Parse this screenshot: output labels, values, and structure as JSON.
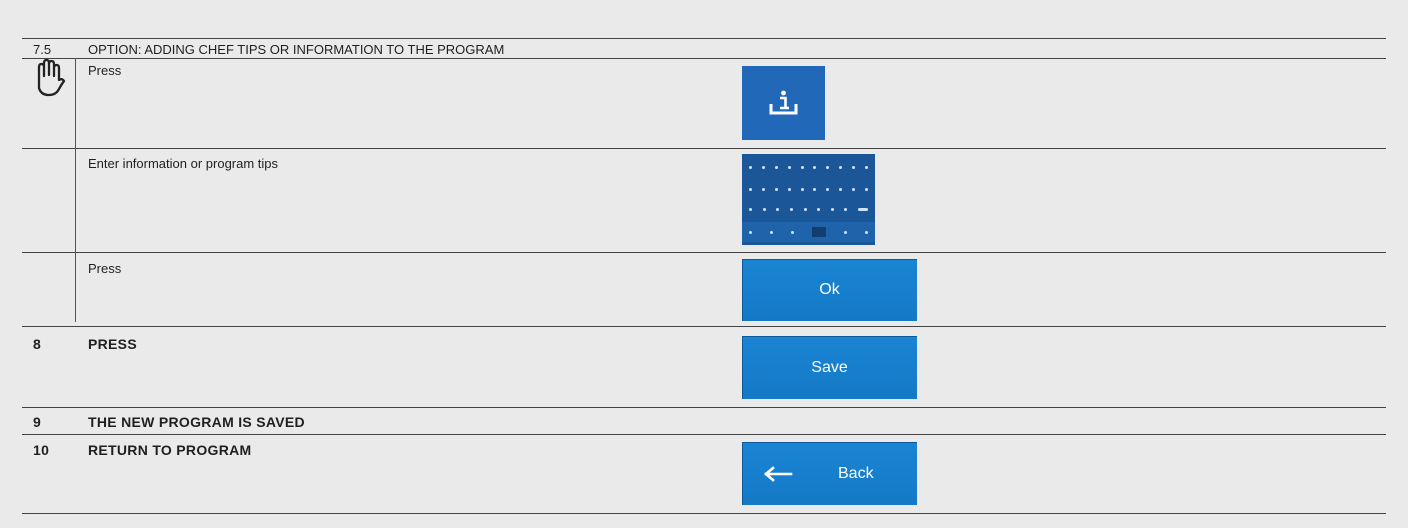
{
  "section": {
    "number": "7.5",
    "title": "OPTION: ADDING CHEF TIPS OR INFORMATION TO THE PROGRAM",
    "icon": "hand-icon"
  },
  "steps": [
    {
      "text": "Press",
      "control": "info-tile",
      "icon": "info-tray-icon"
    },
    {
      "text": "Enter information or program tips",
      "control": "keyboard-thumbnail"
    },
    {
      "text": "Press",
      "button_label": "Ok"
    }
  ],
  "numbered": [
    {
      "number": "8",
      "text": "PRESS",
      "button_label": "Save"
    },
    {
      "number": "9",
      "text": "THE NEW PROGRAM IS SAVED"
    },
    {
      "number": "10",
      "text": "RETURN TO PROGRAM",
      "button_label": "Back",
      "button_icon": "arrow-left-icon"
    }
  ],
  "colors": {
    "button_blue": "#1a7fcc",
    "tile_blue": "#2169b8",
    "background": "#eaeaea",
    "text": "#1f1f1f"
  }
}
